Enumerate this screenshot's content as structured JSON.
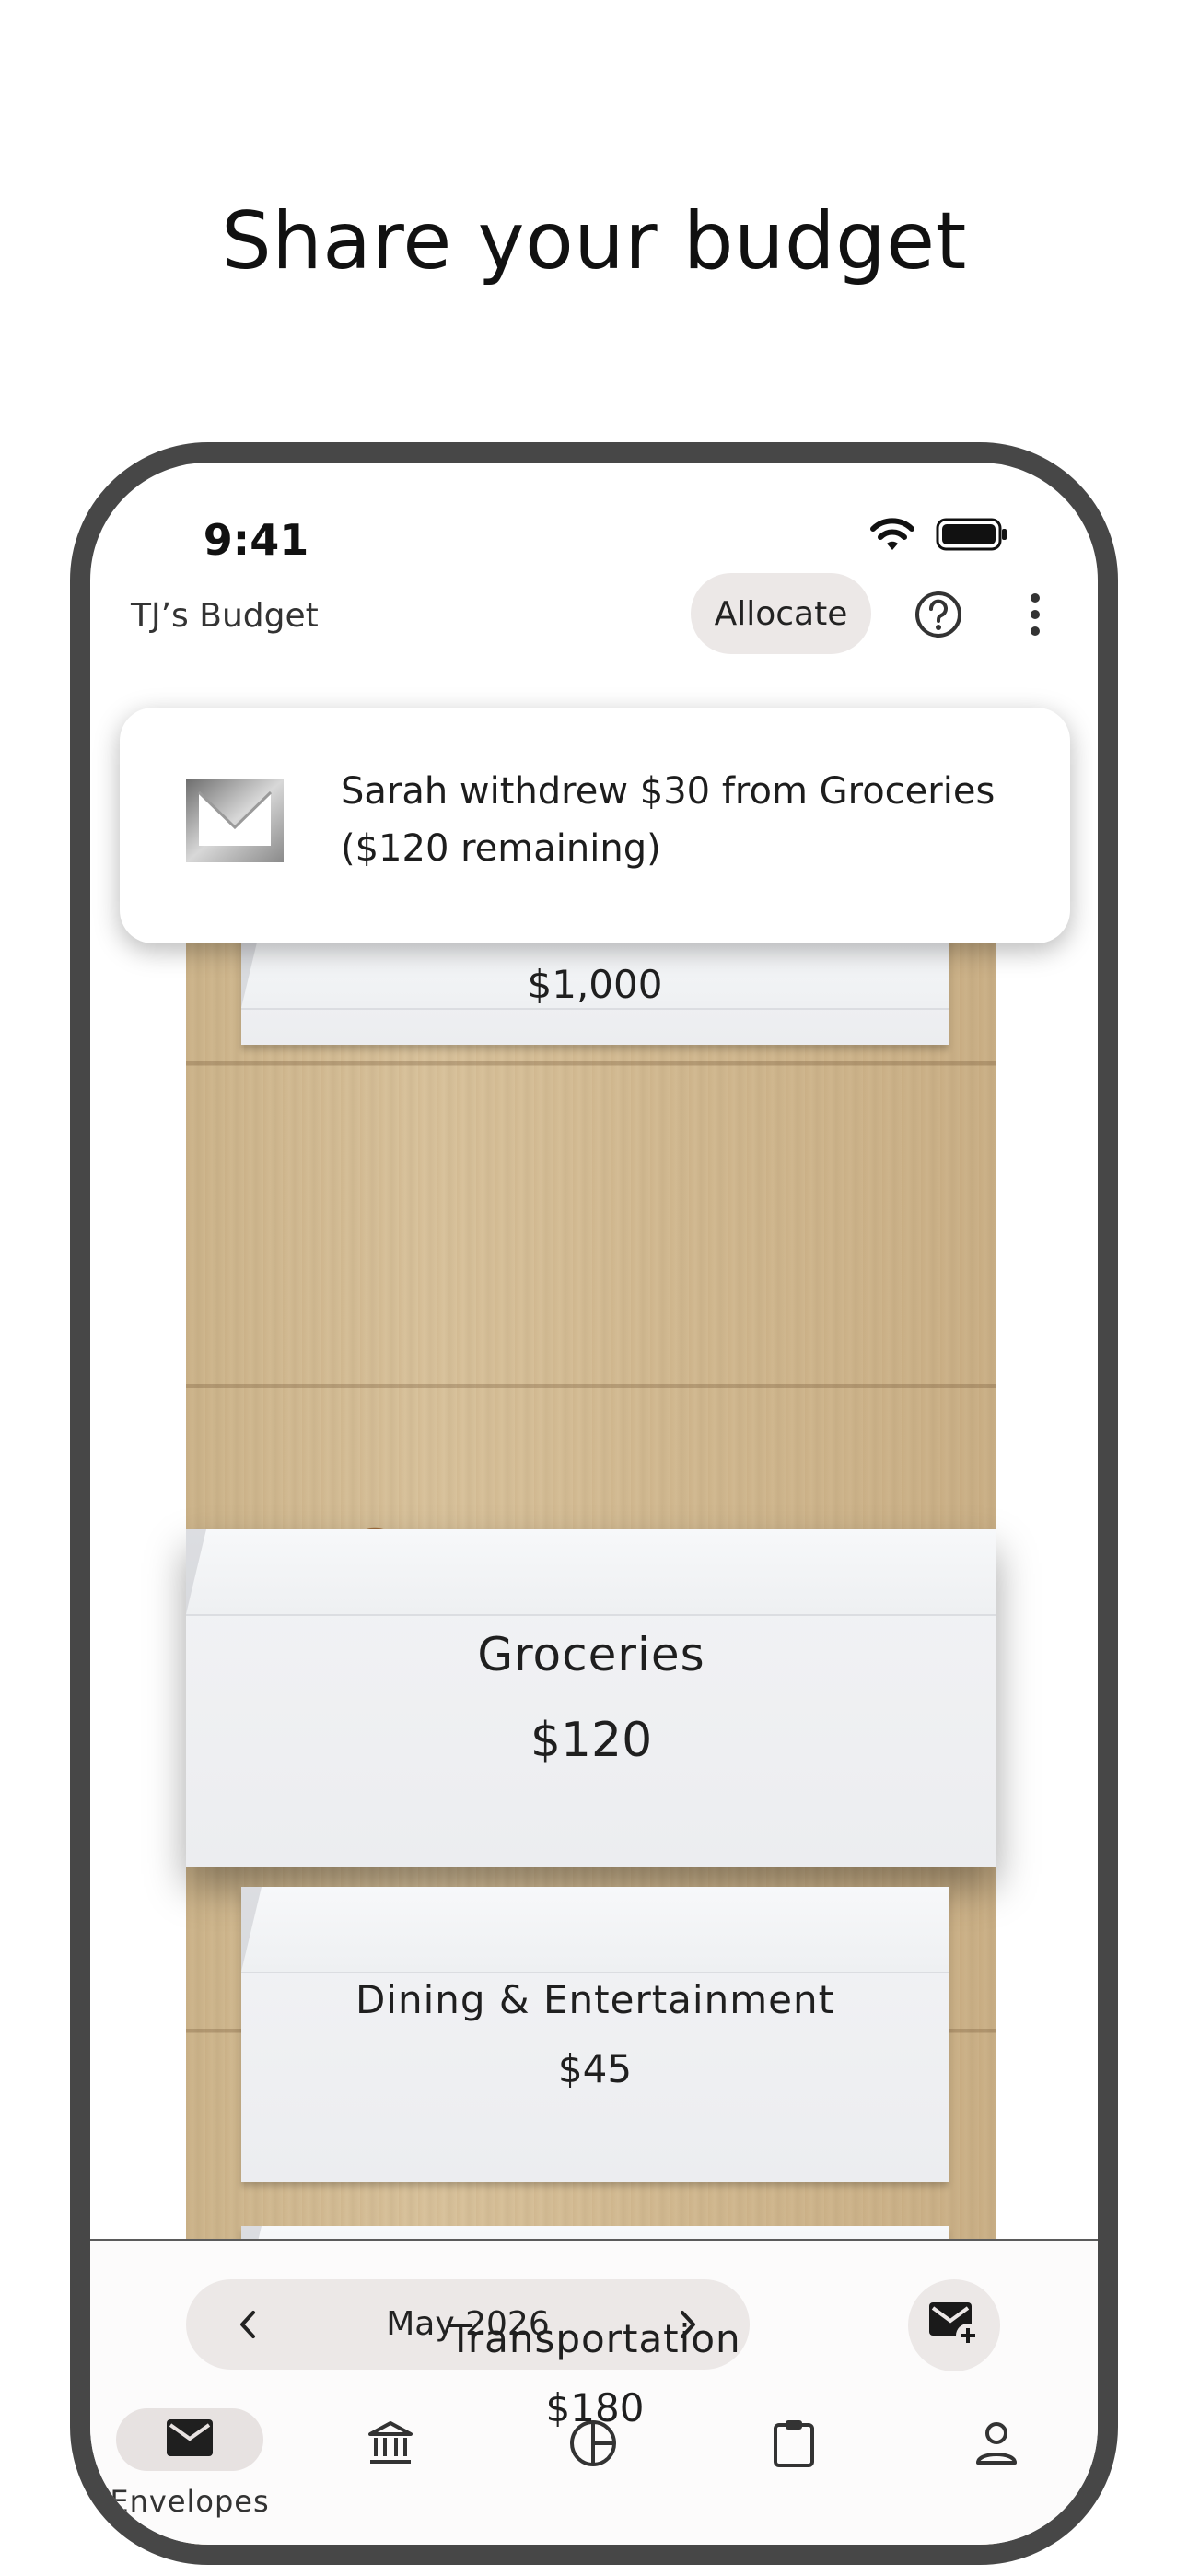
{
  "headline": "Share your budget",
  "status_bar": {
    "time": "9:41",
    "wifi_icon": "wifi-icon",
    "battery_icon": "battery-icon"
  },
  "app_bar": {
    "title": "TJ’s Budget",
    "allocate_label": "Allocate",
    "help_icon": "help-circle-icon",
    "more_icon": "more-vert-icon"
  },
  "notification": {
    "icon": "envelope-logo-icon",
    "message": "Sarah withdrew $30 from Groceries ($120 remaining)"
  },
  "envelopes": [
    {
      "name": "",
      "amount": "$1,000"
    },
    {
      "name": "Groceries",
      "amount": "$120"
    },
    {
      "name": "Dining & Entertainment",
      "amount": "$45"
    },
    {
      "name": "Transportation",
      "amount": "$180"
    },
    {
      "name": "",
      "amount": ""
    }
  ],
  "month_selector": {
    "label": "May 2026",
    "prev_icon": "chevron-left-icon",
    "next_icon": "chevron-right-icon"
  },
  "add_envelope_icon": "add-envelope-icon",
  "bottom_nav": [
    {
      "label": "Envelopes",
      "icon": "mail-icon",
      "active": true
    },
    {
      "label": "",
      "icon": "bank-icon",
      "active": false
    },
    {
      "label": "",
      "icon": "pie-chart-icon",
      "active": false
    },
    {
      "label": "",
      "icon": "clipboard-icon",
      "active": false
    },
    {
      "label": "",
      "icon": "person-icon",
      "active": false
    }
  ],
  "colors": {
    "frame": "#474747",
    "pill": "#ece8e7",
    "wood": "#d6bf98",
    "envelope": "#eff0f2"
  }
}
